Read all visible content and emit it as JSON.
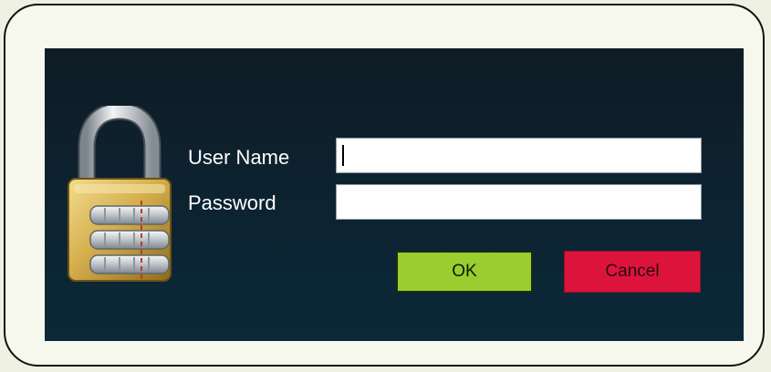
{
  "login_dialog": {
    "username_label": "User Name",
    "password_label": "Password",
    "username_value": "",
    "password_value": "",
    "ok_label": "OK",
    "cancel_label": "Cancel",
    "lock_icon": "combination-padlock-icon"
  },
  "colors": {
    "dialog_background": "#0d222f",
    "ok_button": "#9acd2f",
    "cancel_button": "#dc143c",
    "label_text": "#ffffff"
  }
}
